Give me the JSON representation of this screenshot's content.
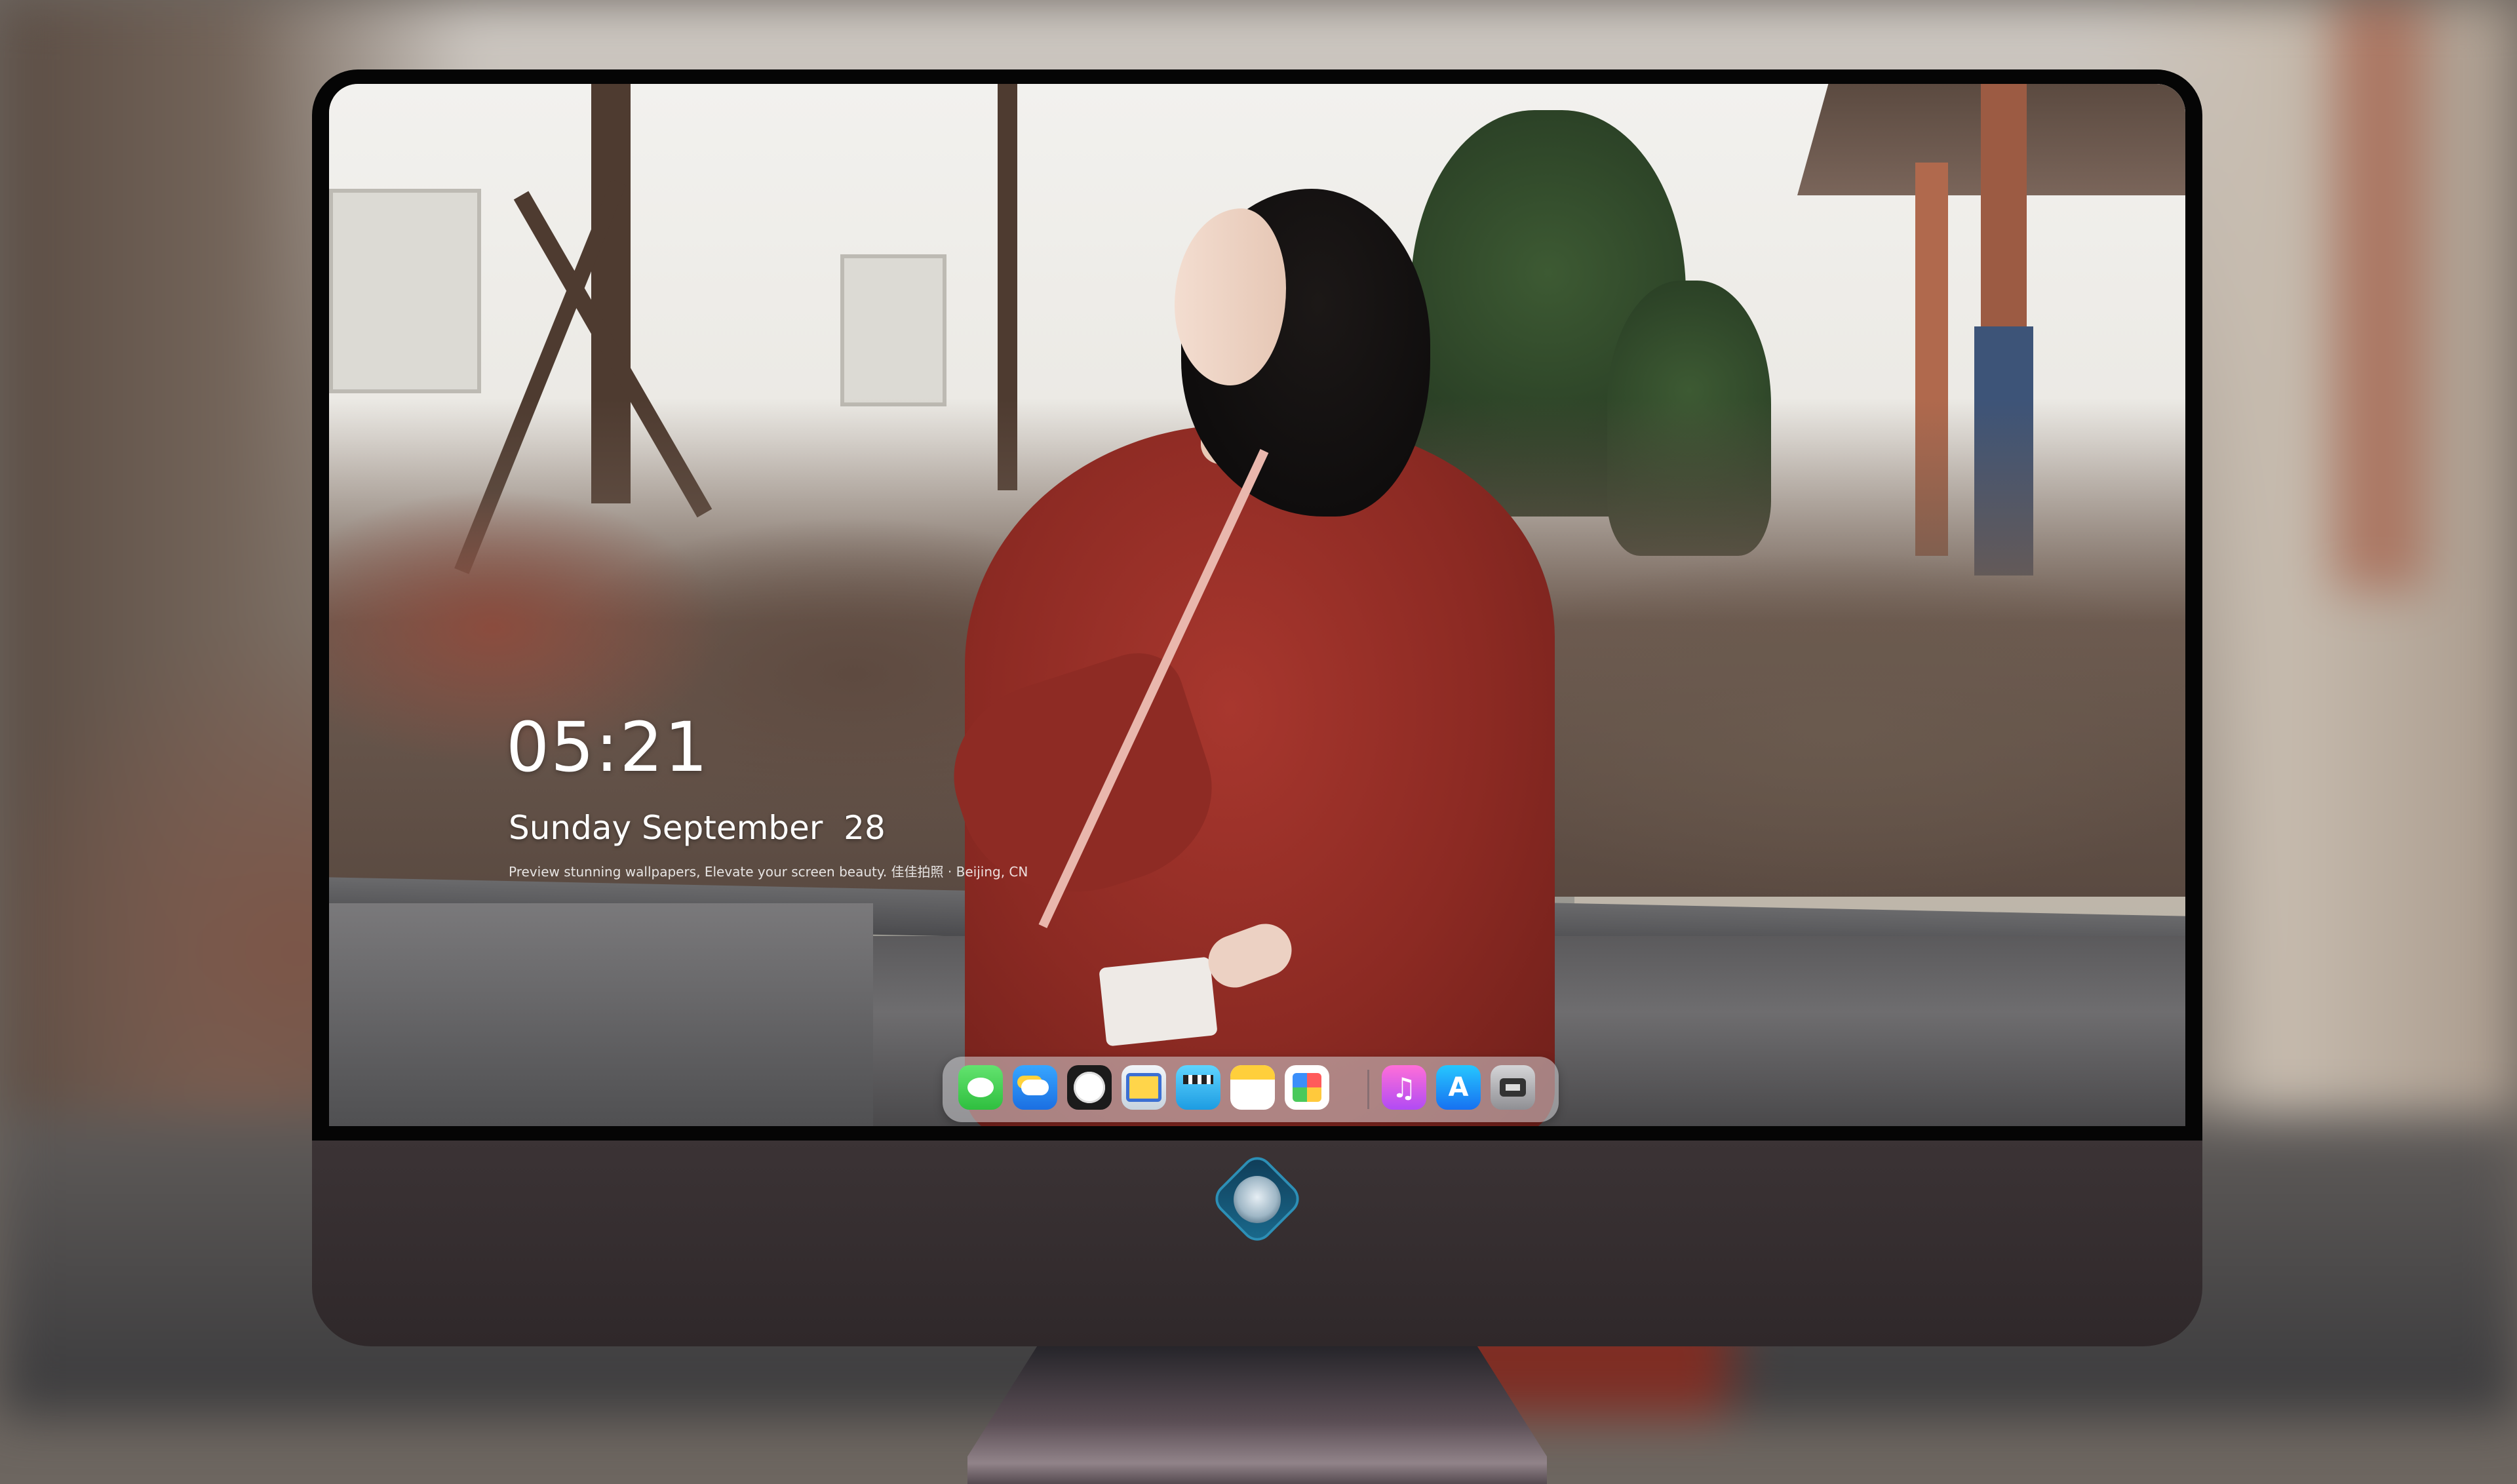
{
  "lock_screen": {
    "time": "05:21",
    "date": "Sunday September  28",
    "caption": "Preview stunning wallpapers, Elevate your screen beauty. 佳佳拍照 · Beijing, CN"
  },
  "dock": {
    "items": [
      {
        "name": "Messages",
        "icon": "messages-icon"
      },
      {
        "name": "Weather",
        "icon": "weather-icon"
      },
      {
        "name": "Clock",
        "icon": "clock-icon"
      },
      {
        "name": "Preview",
        "icon": "preview-icon"
      },
      {
        "name": "Clips",
        "icon": "clapperboard-icon"
      },
      {
        "name": "Notes",
        "icon": "notes-icon"
      },
      {
        "name": "Photos",
        "icon": "photos-icon"
      },
      {
        "name": "Music",
        "icon": "music-icon"
      },
      {
        "name": "App Store",
        "icon": "app-store-icon"
      },
      {
        "name": "Camera",
        "icon": "camera-icon"
      }
    ]
  },
  "monitor": {
    "chin_logo": "dragon-logo-icon"
  },
  "colors": {
    "dock_bg": "#d2d2d6",
    "bezel": "#050505",
    "chin": "#3b3335",
    "sweater": "#8c2a23"
  }
}
